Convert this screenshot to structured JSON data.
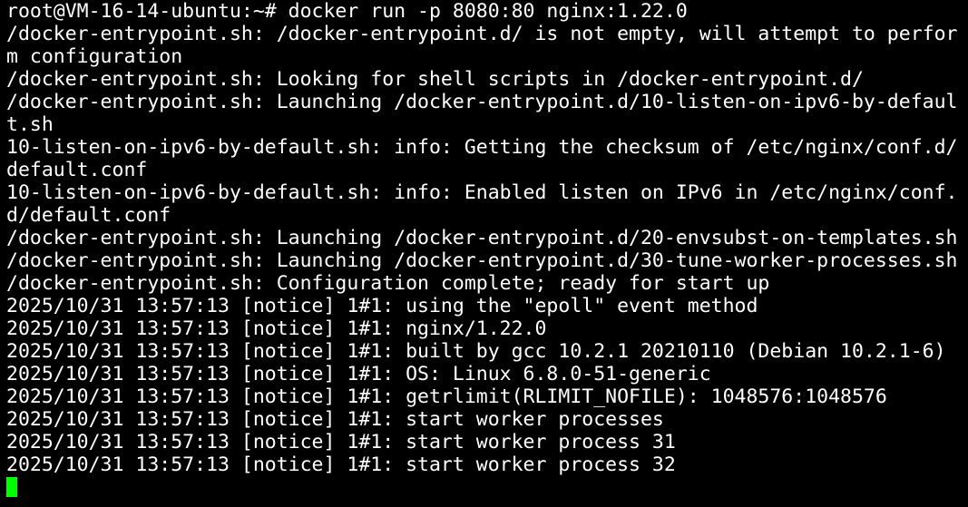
{
  "terminal": {
    "lines": [
      "root@VM-16-14-ubuntu:~# docker run -p 8080:80 nginx:1.22.0",
      "/docker-entrypoint.sh: /docker-entrypoint.d/ is not empty, will attempt to perfor",
      "m configuration",
      "/docker-entrypoint.sh: Looking for shell scripts in /docker-entrypoint.d/",
      "/docker-entrypoint.sh: Launching /docker-entrypoint.d/10-listen-on-ipv6-by-defaul",
      "t.sh",
      "10-listen-on-ipv6-by-default.sh: info: Getting the checksum of /etc/nginx/conf.d/",
      "default.conf",
      "10-listen-on-ipv6-by-default.sh: info: Enabled listen on IPv6 in /etc/nginx/conf.",
      "d/default.conf",
      "/docker-entrypoint.sh: Launching /docker-entrypoint.d/20-envsubst-on-templates.sh",
      "/docker-entrypoint.sh: Launching /docker-entrypoint.d/30-tune-worker-processes.sh",
      "/docker-entrypoint.sh: Configuration complete; ready for start up",
      "2025/10/31 13:57:13 [notice] 1#1: using the \"epoll\" event method",
      "2025/10/31 13:57:13 [notice] 1#1: nginx/1.22.0",
      "2025/10/31 13:57:13 [notice] 1#1: built by gcc 10.2.1 20210110 (Debian 10.2.1-6)",
      "2025/10/31 13:57:13 [notice] 1#1: OS: Linux 6.8.0-51-generic",
      "2025/10/31 13:57:13 [notice] 1#1: getrlimit(RLIMIT_NOFILE): 1048576:1048576",
      "2025/10/31 13:57:13 [notice] 1#1: start worker processes",
      "2025/10/31 13:57:13 [notice] 1#1: start worker process 31",
      "2025/10/31 13:57:13 [notice] 1#1: start worker process 32"
    ],
    "colors": {
      "background": "#000000",
      "text": "#ffffff",
      "cursor": "#00ff00"
    }
  }
}
